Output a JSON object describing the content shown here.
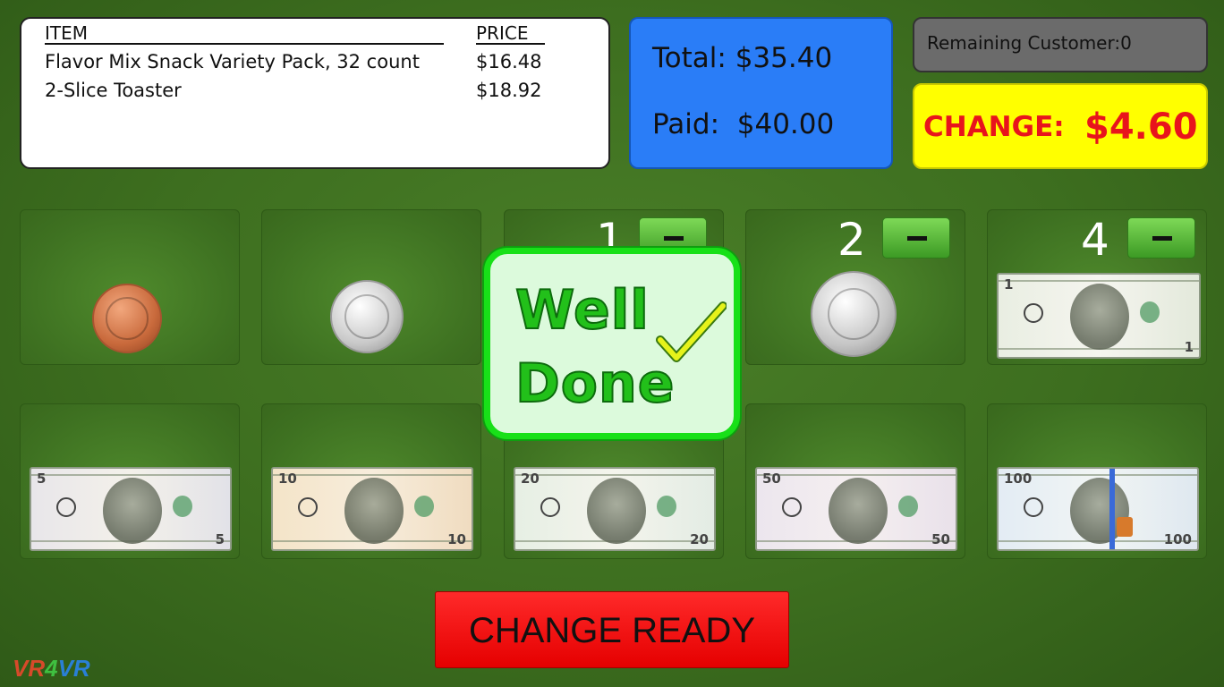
{
  "receipt": {
    "header_item": "ITEM",
    "header_price": "PRICE",
    "items": [
      {
        "name": "Flavor Mix Snack Variety Pack, 32 count",
        "price": "$16.48"
      },
      {
        "name": "2-Slice Toaster",
        "price": "$18.92"
      }
    ]
  },
  "totals": {
    "total_label": "Total:",
    "total_value": "$35.40",
    "paid_label": "Paid:",
    "paid_value": "$40.00"
  },
  "remaining": {
    "text": "Remaining Customer:0"
  },
  "change": {
    "label": "CHANGE:",
    "value": "$4.60"
  },
  "denominations": [
    {
      "name": "penny",
      "count": ""
    },
    {
      "name": "nickel",
      "count": ""
    },
    {
      "name": "dime",
      "count": "1"
    },
    {
      "name": "quarter",
      "count": "2"
    },
    {
      "name": "one-dollar",
      "count": "4"
    },
    {
      "name": "five-dollar",
      "count": "",
      "den": "5"
    },
    {
      "name": "ten-dollar",
      "count": "",
      "den": "10"
    },
    {
      "name": "twenty-dollar",
      "count": "",
      "den": "20"
    },
    {
      "name": "fifty-dollar",
      "count": "",
      "den": "50"
    },
    {
      "name": "hundred-dollar",
      "count": "",
      "den": "100"
    }
  ],
  "one_dollar": {
    "den": "1"
  },
  "popup": {
    "line1": "Well",
    "line2": "Done"
  },
  "actions": {
    "change_ready": "CHANGE READY"
  },
  "logo": {
    "p1": "VR",
    "p2": "4",
    "p3": "VR"
  },
  "colors": {
    "background": "#3d6e1f",
    "totals_bg": "#2a7df7",
    "change_bg": "#ffff00",
    "change_text": "#e8141c",
    "ready_bg": "#ff0000",
    "popup_border": "#18e018"
  }
}
